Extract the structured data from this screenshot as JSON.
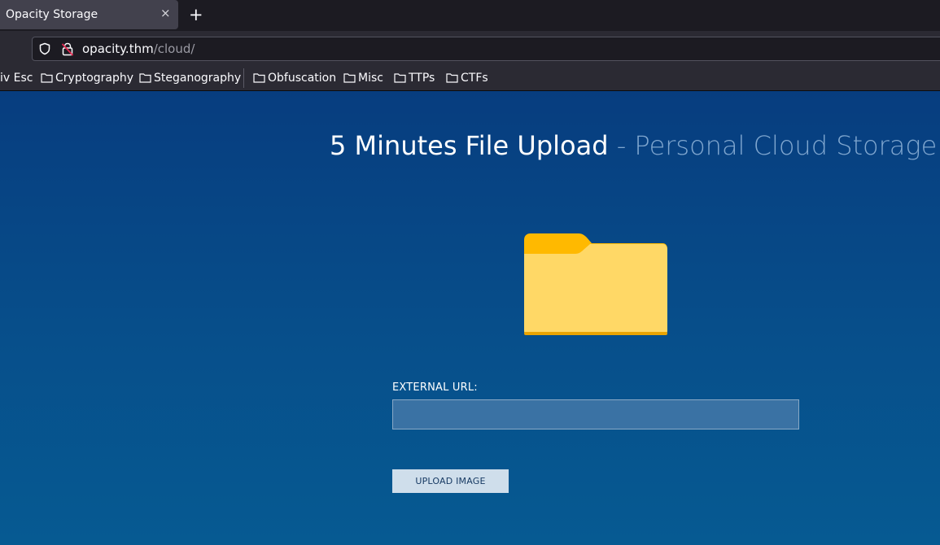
{
  "browser": {
    "tab": {
      "title": "Opacity Storage",
      "close_glyph": "×"
    },
    "new_tab_glyph": "+",
    "url": {
      "host": "opacity.thm",
      "path": "/cloud/"
    },
    "bookmarks": [
      {
        "label": "iv Esc",
        "icon": "none"
      },
      {
        "label": "Cryptography",
        "icon": "folder-icon"
      },
      {
        "label": "Steganography",
        "icon": "folder-icon"
      },
      {
        "label": "Obfuscation",
        "icon": "folder-icon"
      },
      {
        "label": "Misc",
        "icon": "folder-icon"
      },
      {
        "label": "TTPs",
        "icon": "folder-icon"
      },
      {
        "label": "CTFs",
        "icon": "folder-icon"
      }
    ]
  },
  "page": {
    "title": "5 Minutes File Upload",
    "title_separator": " - ",
    "subtitle": "Personal Cloud Storage",
    "form": {
      "url_label": "EXTERNAL URL:",
      "url_value": "",
      "upload_button": "UPLOAD IMAGE"
    }
  },
  "colors": {
    "page_gradient_top": "#073d7f",
    "page_gradient_bottom": "#065a92",
    "folder_front": "#ffd866",
    "folder_tab": "#ffb900"
  }
}
